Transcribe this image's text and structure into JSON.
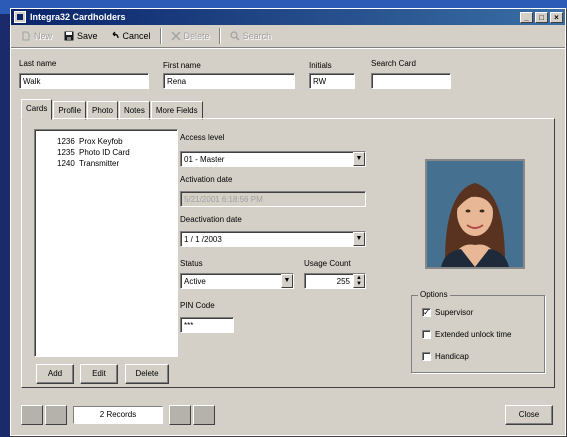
{
  "window": {
    "title": "Integra32 Cardholders"
  },
  "toolbar": {
    "new_label": "New",
    "save_label": "Save",
    "cancel_label": "Cancel",
    "delete_label": "Delete",
    "search_label": "Search"
  },
  "header": {
    "last_name_label": "Last name",
    "last_name_value": "Walk",
    "first_name_label": "First name",
    "first_name_value": "Rena",
    "initials_label": "Initials",
    "initials_value": "RW",
    "search_card_label": "Search Card",
    "search_card_value": ""
  },
  "tabs": [
    "Cards",
    "Profile",
    "Photo",
    "Notes",
    "More Fields"
  ],
  "cards": [
    {
      "num": "1236",
      "name": "Prox Keyfob"
    },
    {
      "num": "1235",
      "name": "Photo ID Card"
    },
    {
      "num": "1240",
      "name": "Transmitter"
    }
  ],
  "form": {
    "access_level_label": "Access level",
    "access_level_value": "01 - Master",
    "activation_date_label": "Activation date",
    "activation_date_value": "5/21/2001 6:18:56 PM",
    "deactivation_date_label": "Deactivation date",
    "deactivation_date_value": "1 / 1 /2003",
    "status_label": "Status",
    "status_value": "Active",
    "usage_count_label": "Usage Count",
    "usage_count_value": "255",
    "pin_code_label": "PIN Code",
    "pin_code_value": "***"
  },
  "list_buttons": {
    "add": "Add",
    "edit": "Edit",
    "delete": "Delete"
  },
  "options": {
    "legend": "Options",
    "supervisor": "Supervisor",
    "extended_unlock": "Extended unlock time",
    "handicap": "Handicap"
  },
  "status_bar": {
    "records": "2 Records",
    "close_label": "Close"
  },
  "colors": {
    "title_start": "#0a246a",
    "title_end": "#3a6ea5",
    "face": "#d4d0c8"
  }
}
